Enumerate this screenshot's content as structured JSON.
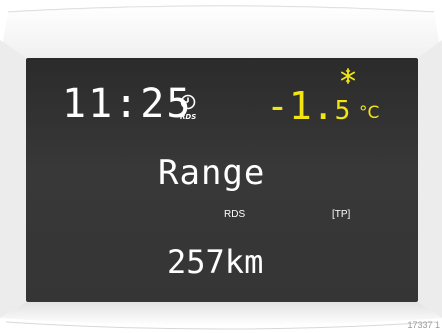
{
  "display": {
    "time": "11:25",
    "clock_icon": "clock-icon",
    "clock_sub_label": "RDS",
    "frost_icon": "snowflake-icon",
    "temperature_main": "-1.",
    "temperature_decimal": "5",
    "temperature_unit": "°C",
    "mode_label": "Range",
    "rds_label": "RDS",
    "tp_label": "[TP]",
    "range_value": "257km"
  },
  "colors": {
    "screen_bg": "#333333",
    "text": "#ffffff",
    "temperature": "#f2e512"
  },
  "figure_ref": "17337 1"
}
